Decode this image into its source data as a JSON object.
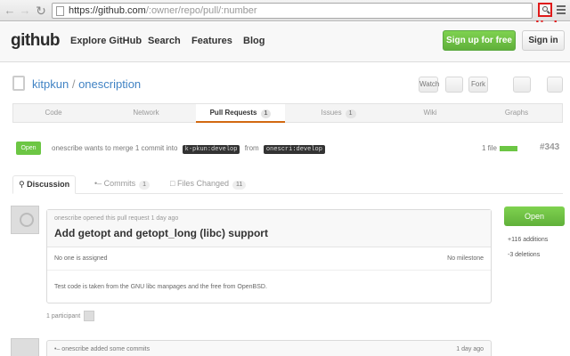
{
  "browser": {
    "url_host": "https://github.com",
    "url_path": "/:owner/repo/pull/:number",
    "annotation": "click"
  },
  "header": {
    "logo": "github",
    "nav": [
      "Explore GitHub",
      "Search",
      "Features",
      "Blog"
    ],
    "signup_label": "Sign up for free",
    "signin_label": "Sign in"
  },
  "repo": {
    "owner": "kitpkun",
    "name": "onescription",
    "actions": [
      "Watch",
      "Fork"
    ]
  },
  "repo_tabs": [
    {
      "label": "Code"
    },
    {
      "label": "Network"
    },
    {
      "label": "Pull Requests",
      "count": "1"
    },
    {
      "label": "Issues",
      "count": "1"
    },
    {
      "label": "Wiki"
    },
    {
      "label": "Graphs"
    }
  ],
  "pr": {
    "state_badge": "Open",
    "meta_text": "onescribe wants to merge 1 commit into",
    "base_branch": "k-pkun:develop",
    "from_text": "from",
    "head_branch": "onescri:develop",
    "number": "#343",
    "title": "Add getopt and getopt_long (libc) support",
    "opened_by": "onescribe opened this pull request 1 day ago",
    "assignee": "No one is assigned",
    "milestone": "No milestone",
    "body": "Test code is taken from the GNU libc manpages and the free from OpenBSD.",
    "participants": "1 participant"
  },
  "pr_tabs": [
    {
      "label": "Discussion",
      "count": ""
    },
    {
      "label": "Commits",
      "count": "1"
    },
    {
      "label": "Files Changed",
      "count": "11"
    }
  ],
  "sidebar": {
    "state": "Open",
    "additions": "+116 additions",
    "deletions": "-3 deletions"
  },
  "commit": {
    "text": "onescribe added some commits",
    "when": "1 day ago"
  }
}
